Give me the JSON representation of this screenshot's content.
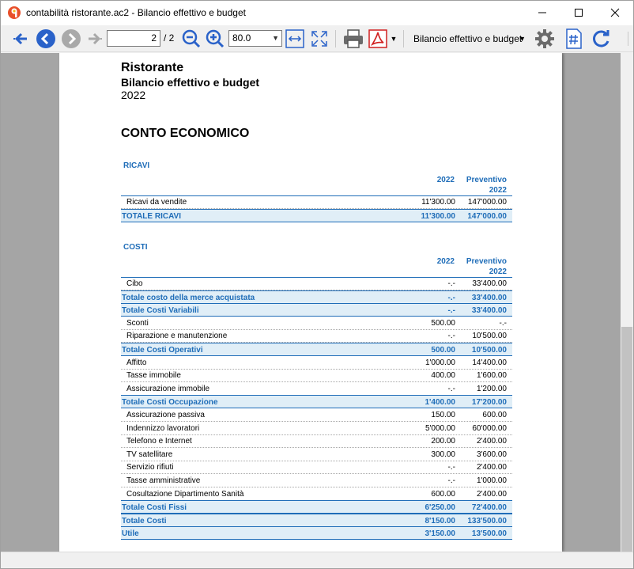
{
  "window": {
    "title": "contabilità ristorante.ac2 - Bilancio effettivo e budget"
  },
  "toolbar": {
    "page_current": "2",
    "page_total": "/ 2",
    "zoom_value": "80.0",
    "report_select": "Bilancio effettivo e budget",
    "icons": [
      "first-page-icon",
      "back-icon",
      "forward-icon",
      "last-page-icon",
      "zoom-out-icon",
      "zoom-in-icon",
      "fit-width-icon",
      "fit-page-icon",
      "print-icon",
      "pdf-icon",
      "settings-icon",
      "page-numbering-icon",
      "refresh-icon"
    ]
  },
  "colors": {
    "accent": "#1f6db8",
    "total_bg": "#e0eef7",
    "pdf_red": "#d11f1f",
    "nav_blue": "#2a62c9"
  },
  "report": {
    "company": "Ristorante",
    "title": "Bilancio effettivo e budget",
    "year": "2022",
    "section": "CONTO ECONOMICO",
    "ricavi": {
      "title": "RICAVI",
      "col1": "2022",
      "col2_line1": "Preventivo",
      "col2_line2": "2022",
      "rows": [
        {
          "label": "Ricavi da vendite",
          "v1": "11'300.00",
          "v2": "147'000.00",
          "total": false
        },
        {
          "label": "TOTALE RICAVI",
          "v1": "11'300.00",
          "v2": "147'000.00",
          "total": true
        }
      ]
    },
    "costi": {
      "title": "COSTI",
      "col1": "2022",
      "col2_line1": "Preventivo",
      "col2_line2": "2022",
      "rows": [
        {
          "label": "Cibo",
          "v1": "-.-",
          "v2": "33'400.00",
          "total": false
        },
        {
          "label": "Totale costo della merce acquistata",
          "v1": "-.-",
          "v2": "33'400.00",
          "total": true
        },
        {
          "label": "Totale Costi Variabili",
          "v1": "-.-",
          "v2": "33'400.00",
          "total": true
        },
        {
          "label": "Sconti",
          "v1": "500.00",
          "v2": "-.-",
          "total": false
        },
        {
          "label": "Riparazione e manutenzione",
          "v1": "-.-",
          "v2": "10'500.00",
          "total": false
        },
        {
          "label": "Totale Costi Operativi",
          "v1": "500.00",
          "v2": "10'500.00",
          "total": true
        },
        {
          "label": "Affitto",
          "v1": "1'000.00",
          "v2": "14'400.00",
          "total": false
        },
        {
          "label": "Tasse immobile",
          "v1": "400.00",
          "v2": "1'600.00",
          "total": false
        },
        {
          "label": "Assicurazione immobile",
          "v1": "-.-",
          "v2": "1'200.00",
          "total": false
        },
        {
          "label": "Totale Costi Occupazione",
          "v1": "1'400.00",
          "v2": "17'200.00",
          "total": true
        },
        {
          "label": "Assicurazione passiva",
          "v1": "150.00",
          "v2": "600.00",
          "total": false
        },
        {
          "label": "Indennizzo lavoratori",
          "v1": "5'000.00",
          "v2": "60'000.00",
          "total": false
        },
        {
          "label": "Telefono e Internet",
          "v1": "200.00",
          "v2": "2'400.00",
          "total": false
        },
        {
          "label": "TV satellitare",
          "v1": "300.00",
          "v2": "3'600.00",
          "total": false
        },
        {
          "label": "Servizio rifiuti",
          "v1": "-.-",
          "v2": "2'400.00",
          "total": false
        },
        {
          "label": "Tasse amministrative",
          "v1": "-.-",
          "v2": "1'000.00",
          "total": false
        },
        {
          "label": "Cosultazione Dipartimento Sanità",
          "v1": "600.00",
          "v2": "2'400.00",
          "total": false
        },
        {
          "label": "Totale Costi Fissi",
          "v1": "6'250.00",
          "v2": "72'400.00",
          "total": true
        },
        {
          "label": "Totale Costi",
          "v1": "8'150.00",
          "v2": "133'500.00",
          "total": true
        },
        {
          "label": "Utile",
          "v1": "3'150.00",
          "v2": "13'500.00",
          "total": true
        }
      ]
    }
  }
}
